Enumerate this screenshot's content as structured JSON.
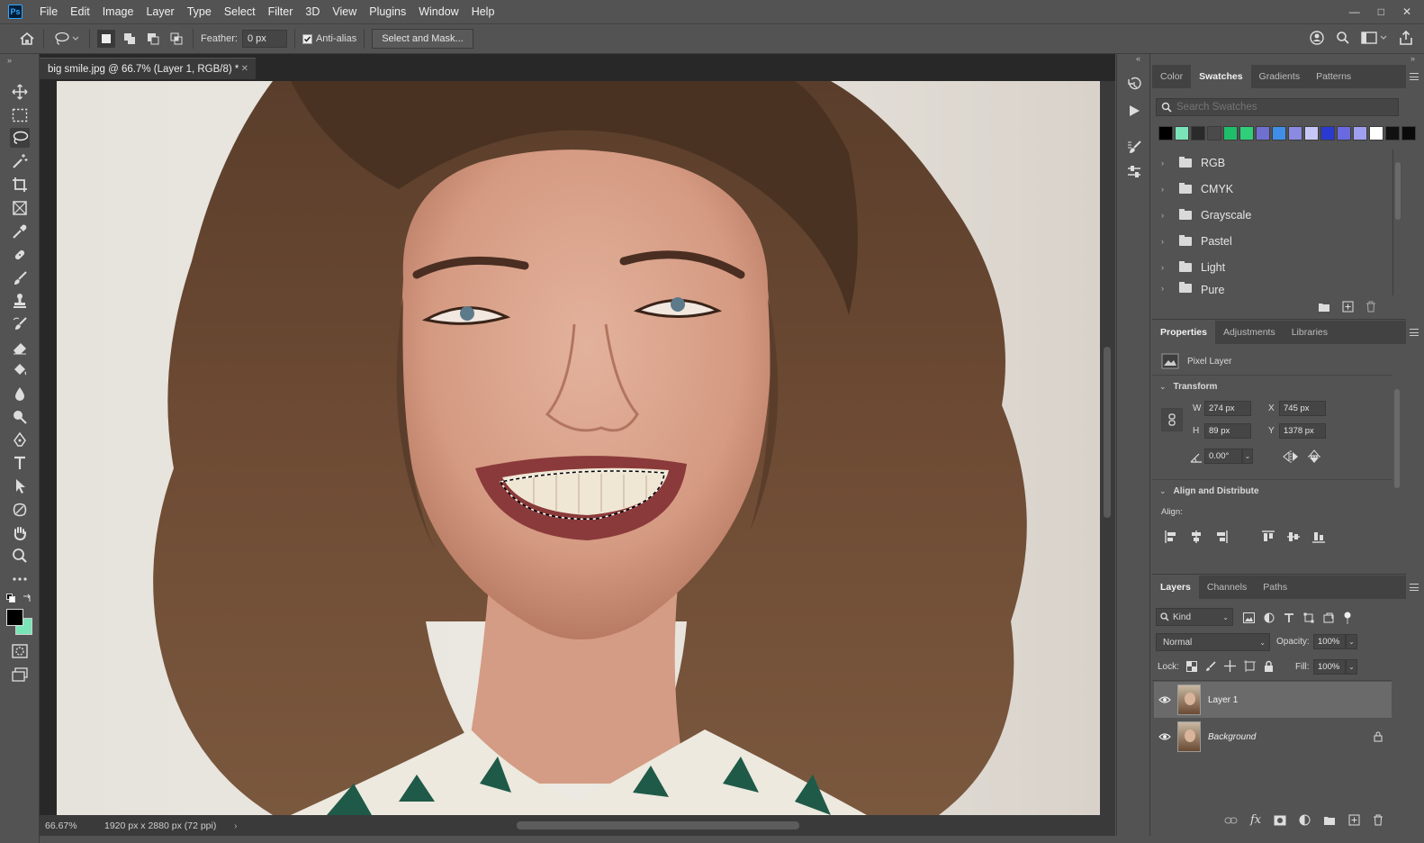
{
  "app": {
    "logo": "Ps"
  },
  "menu": [
    "File",
    "Edit",
    "Image",
    "Layer",
    "Type",
    "Select",
    "Filter",
    "3D",
    "View",
    "Plugins",
    "Window",
    "Help"
  ],
  "window_controls": {
    "minimize": "—",
    "restore": "□",
    "close": "✕"
  },
  "options": {
    "feather_label": "Feather:",
    "feather_value": "0 px",
    "antialias_label": "Anti-alias",
    "select_mask_label": "Select and Mask..."
  },
  "document": {
    "tab_title": "big smile.jpg @ 66.7% (Layer 1, RGB/8) *",
    "zoom": "66.67%",
    "info": "1920 px x 2880 px (72 ppi)"
  },
  "swatches_panel": {
    "tabs": [
      "Color",
      "Swatches",
      "Gradients",
      "Patterns"
    ],
    "active_tab": "Swatches",
    "search_placeholder": "Search Swatches",
    "colors": [
      "#000000",
      "#7be3b8",
      "#2a2a2a",
      "#4a4a4a",
      "#1fbf6a",
      "#2fcf7a",
      "#7070d0",
      "#3f8fe8",
      "#8a8ae0",
      "#c8c8f8",
      "#2a3ad0",
      "#6a6ae0",
      "#a0a0f0",
      "#ffffff",
      "#111111",
      "#0a0a0a"
    ],
    "groups": [
      "RGB",
      "CMYK",
      "Grayscale",
      "Pastel",
      "Light",
      "Pure"
    ]
  },
  "properties_panel": {
    "tabs": [
      "Properties",
      "Adjustments",
      "Libraries"
    ],
    "active_tab": "Properties",
    "layer_kind": "Pixel Layer",
    "transform_label": "Transform",
    "w_label": "W",
    "w_value": "274 px",
    "h_label": "H",
    "h_value": "89 px",
    "x_label": "X",
    "x_value": "745 px",
    "y_label": "Y",
    "y_value": "1378 px",
    "angle_value": "0.00°",
    "align_section_label": "Align and Distribute",
    "align_label": "Align:"
  },
  "layers_panel": {
    "tabs": [
      "Layers",
      "Channels",
      "Paths"
    ],
    "active_tab": "Layers",
    "filter_kind": "Kind",
    "blend_mode": "Normal",
    "opacity_label": "Opacity:",
    "opacity_value": "100%",
    "lock_label": "Lock:",
    "fill_label": "Fill:",
    "fill_value": "100%",
    "layers": [
      {
        "name": "Layer 1",
        "selected": true,
        "locked": false
      },
      {
        "name": "Background",
        "selected": false,
        "locked": true
      }
    ]
  },
  "colors": {
    "foreground": "#000000",
    "background": "#7be3b8",
    "accent": "#31a8ff"
  }
}
